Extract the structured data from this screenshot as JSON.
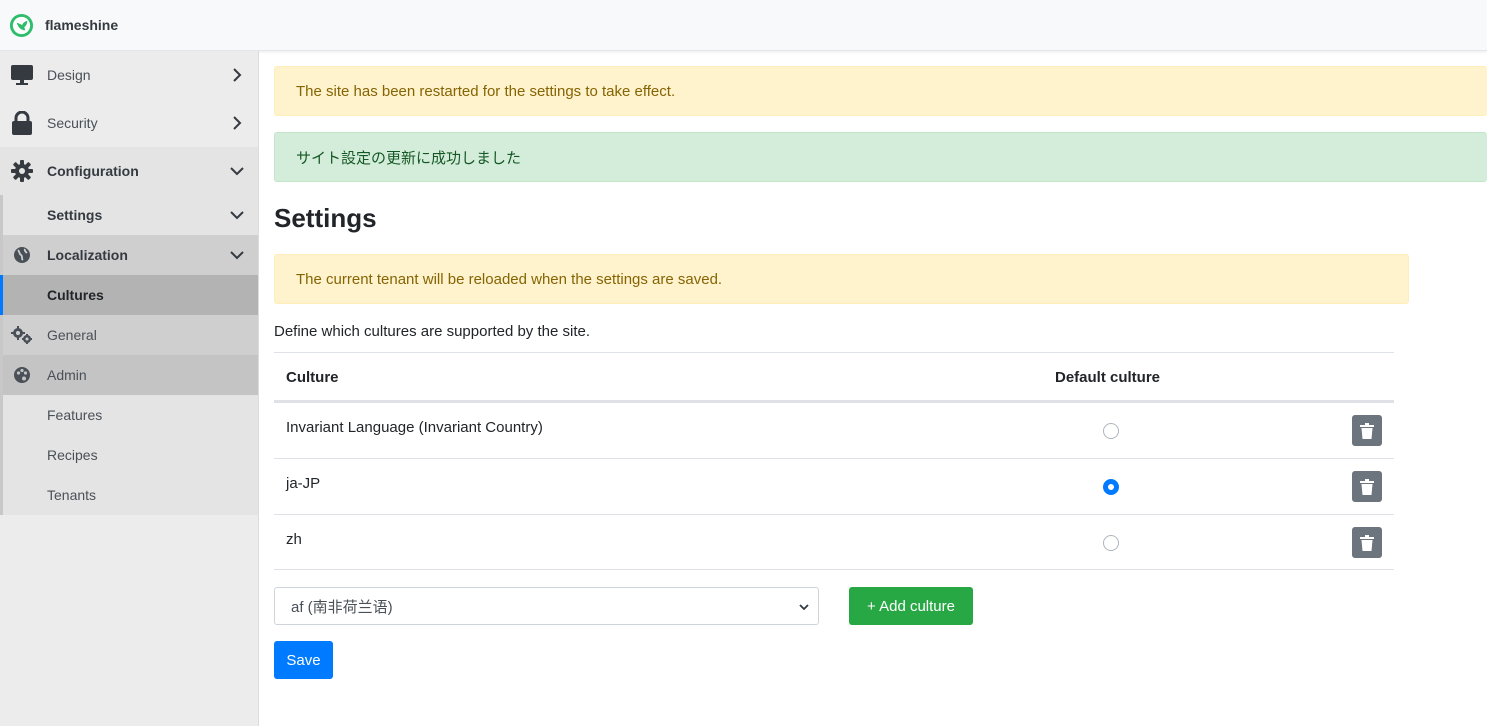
{
  "app": {
    "name": "flameshine"
  },
  "sidebar": {
    "items": [
      {
        "label": "Design",
        "icon": "monitor-icon"
      },
      {
        "label": "Security",
        "icon": "lock-icon"
      },
      {
        "label": "Configuration",
        "icon": "gear-icon"
      },
      {
        "label": "Settings"
      },
      {
        "label": "Localization",
        "icon": "globe-icon"
      },
      {
        "label": "Cultures"
      },
      {
        "label": "General",
        "icon": "gears-icon"
      },
      {
        "label": "Admin",
        "icon": "palette-icon"
      },
      {
        "label": "Features"
      },
      {
        "label": "Recipes"
      },
      {
        "label": "Tenants"
      }
    ]
  },
  "alerts": {
    "restart": "The site has been restarted for the settings to take effect.",
    "success": "サイト設定の更新に成功しました",
    "reload": "The current tenant will be reloaded when the settings are saved."
  },
  "page": {
    "title": "Settings",
    "description": "Define which cultures are supported by the site."
  },
  "table": {
    "headers": {
      "culture": "Culture",
      "default": "Default culture"
    },
    "rows": [
      {
        "culture": "Invariant Language (Invariant Country)",
        "is_default": false
      },
      {
        "culture": "ja-JP",
        "is_default": true
      },
      {
        "culture": "zh",
        "is_default": false
      }
    ]
  },
  "add_culture": {
    "selected": "af (南非荷兰语)",
    "button_label": "+ Add culture"
  },
  "save_label": "Save",
  "colors": {
    "primary": "#007bff",
    "success": "#28a745",
    "secondary": "#6c757d"
  }
}
